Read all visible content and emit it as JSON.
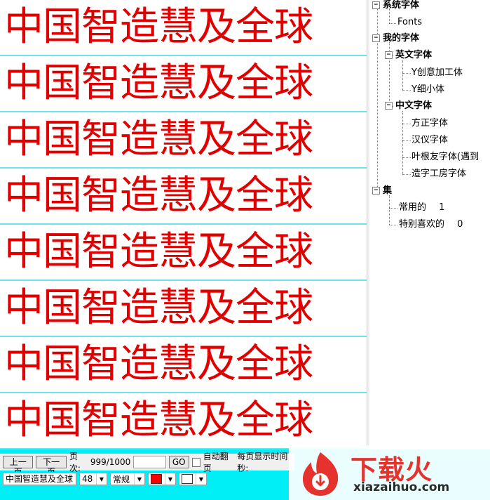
{
  "preview": {
    "sample_text": "中国智造慧及全球",
    "text_color": "#e00000",
    "separator_color": "#6fe3ea",
    "rows": 8
  },
  "tree": {
    "system_fonts": {
      "label": "系统字体",
      "children": [
        "Fonts"
      ]
    },
    "my_fonts": {
      "label": "我的字体",
      "english": {
        "label": "英文字体",
        "children": [
          "Y创意加工体",
          "Y细小体"
        ]
      },
      "chinese": {
        "label": "中文字体",
        "children": [
          "方正字体",
          "汉仪字体",
          "叶根友字体(遇到",
          "造字工房字体"
        ]
      }
    },
    "collections": {
      "label": "集",
      "children": [
        {
          "label": "常用的",
          "count": "1"
        },
        {
          "label": "特别喜欢的",
          "count": "0"
        }
      ]
    }
  },
  "toolbar": {
    "prev_label": "上一页",
    "next_label": "下一页",
    "page_label": "页次:",
    "page_value": "999/1000",
    "go_label": "GO",
    "autoflip_label": "自动翻页",
    "interval_label": "每页显示时间秒:",
    "sample_input": "中国智造慧及全球",
    "size_value": "48",
    "style_value": "常规",
    "fg_color": "#ff0000",
    "bg_color": "#ffffff"
  },
  "watermark": {
    "title": "下载火",
    "domain": "xiazaihuo.com",
    "brand_color": "#e5322d"
  }
}
